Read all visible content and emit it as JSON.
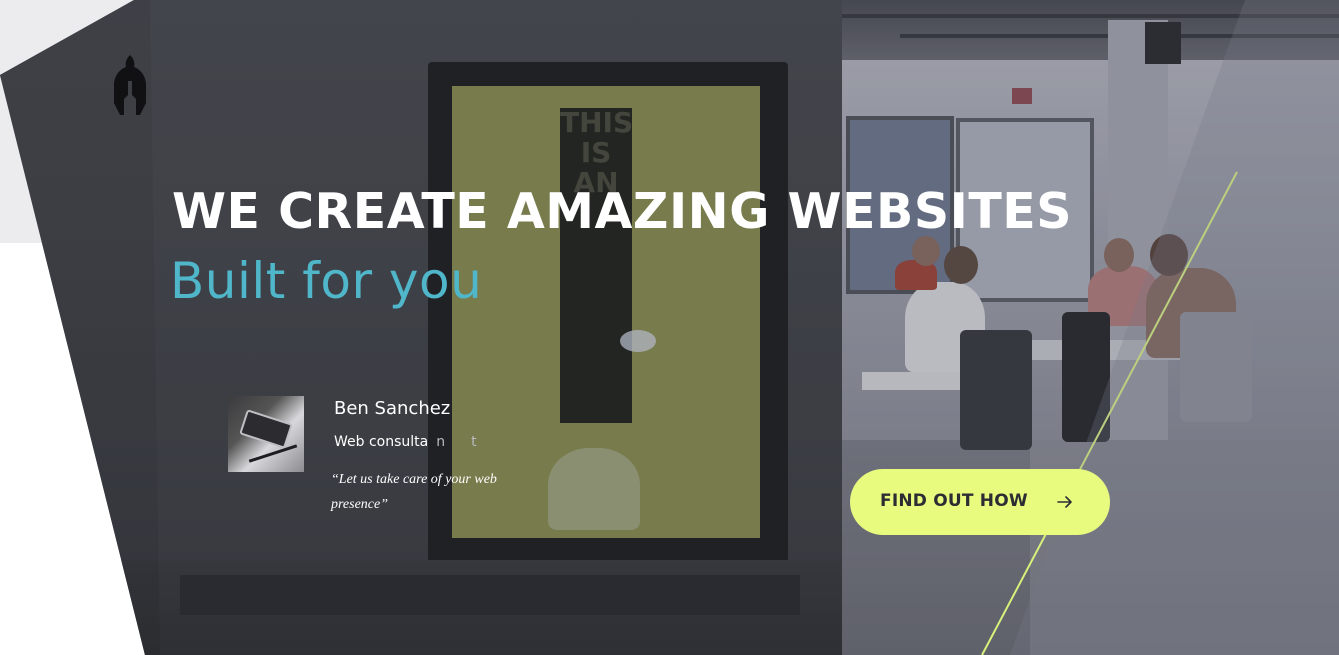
{
  "hero": {
    "headline": "WE CREATE AMAZING WEBSITES",
    "subheadline": "Built for you"
  },
  "author": {
    "name": "Ben Sanchez",
    "role_main": "Web consulta",
    "role_faint_1": "n",
    "role_faint_2": "t",
    "quote": "“Let us take care of your web presence”"
  },
  "cta": {
    "label": "FIND OUT HOW",
    "icon": "arrow-right-icon"
  },
  "logo": {
    "icon": "spartan-helmet-icon"
  },
  "colors": {
    "accent_cyan": "#4fb7c9",
    "cta_lime": "#e8fb7f",
    "diagonal_line": "#d6f27a",
    "headline": "#ffffff"
  }
}
